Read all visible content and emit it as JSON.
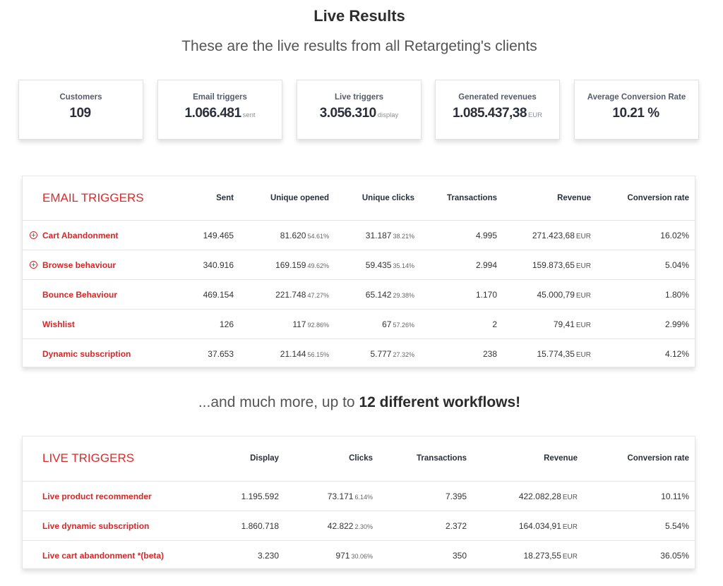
{
  "header": {
    "title": "Live Results",
    "subtitle": "These are the live results from all Retargeting's clients"
  },
  "stats": [
    {
      "label": "Customers",
      "value": "109",
      "unit": ""
    },
    {
      "label": "Email triggers",
      "value": "1.066.481",
      "unit": "sent"
    },
    {
      "label": "Live triggers",
      "value": "3.056.310",
      "unit": "display"
    },
    {
      "label": "Generated revenues",
      "value": "1.085.437,38",
      "unit": "EUR"
    },
    {
      "label": "Average Conversion Rate",
      "value": "10.21 %",
      "unit": ""
    }
  ],
  "email": {
    "title": "EMAIL TRIGGERS",
    "headers": {
      "sent": "Sent",
      "opened": "Unique opened",
      "clicks": "Unique clicks",
      "transactions": "Transactions",
      "revenue": "Revenue",
      "conversion": "Conversion rate"
    },
    "rows": [
      {
        "name": "Cart Abandonment",
        "expand": "+",
        "sent": "149.465",
        "opened": "81.620",
        "opened_pct": "54.61%",
        "clicks": "31.187",
        "clicks_pct": "38.21%",
        "transactions": "4.995",
        "revenue": "271.423,68",
        "currency": "EUR",
        "conversion": "16.02%"
      },
      {
        "name": "Browse behaviour",
        "expand": "+",
        "sent": "340.916",
        "opened": "169.159",
        "opened_pct": "49.62%",
        "clicks": "59.435",
        "clicks_pct": "35.14%",
        "transactions": "2.994",
        "revenue": "159.873,65",
        "currency": "EUR",
        "conversion": "5.04%"
      },
      {
        "name": "Bounce Behaviour",
        "expand": "",
        "sent": "469.154",
        "opened": "221.748",
        "opened_pct": "47.27%",
        "clicks": "65.142",
        "clicks_pct": "29.38%",
        "transactions": "1.170",
        "revenue": "45.000,79",
        "currency": "EUR",
        "conversion": "1.80%"
      },
      {
        "name": "Wishlist",
        "expand": "",
        "sent": "126",
        "opened": "117",
        "opened_pct": "92.86%",
        "clicks": "67",
        "clicks_pct": "57.26%",
        "transactions": "2",
        "revenue": "79,41",
        "currency": "EUR",
        "conversion": "2.99%"
      },
      {
        "name": "Dynamic subscription",
        "expand": "",
        "sent": "37.653",
        "opened": "21.144",
        "opened_pct": "56.15%",
        "clicks": "5.777",
        "clicks_pct": "27.32%",
        "transactions": "238",
        "revenue": "15.774,35",
        "currency": "EUR",
        "conversion": "4.12%"
      }
    ]
  },
  "more": {
    "prefix": "...and much more, up to ",
    "bold": "12 different workflows!"
  },
  "live": {
    "title": "LIVE TRIGGERS",
    "headers": {
      "display": "Display",
      "clicks": "Clicks",
      "transactions": "Transactions",
      "revenue": "Revenue",
      "conversion": "Conversion rate"
    },
    "rows": [
      {
        "name": "Live product recommender",
        "display": "1.195.592",
        "clicks": "73.171",
        "clicks_pct": "6.14%",
        "transactions": "7.395",
        "revenue": "422.082,28",
        "currency": "EUR",
        "conversion": "10.11%"
      },
      {
        "name": "Live dynamic subscription",
        "display": "1.860.718",
        "clicks": "42.822",
        "clicks_pct": "2.30%",
        "transactions": "2.372",
        "revenue": "164.034,91",
        "currency": "EUR",
        "conversion": "5.54%"
      },
      {
        "name": "Live cart abandonment *(beta)",
        "display": "3.230",
        "clicks": "971",
        "clicks_pct": "30.06%",
        "transactions": "350",
        "revenue": "18.273,55",
        "currency": "EUR",
        "conversion": "36.05%"
      }
    ]
  },
  "colors": {
    "accent": "#d62828",
    "heading": "#2a2f3c"
  }
}
